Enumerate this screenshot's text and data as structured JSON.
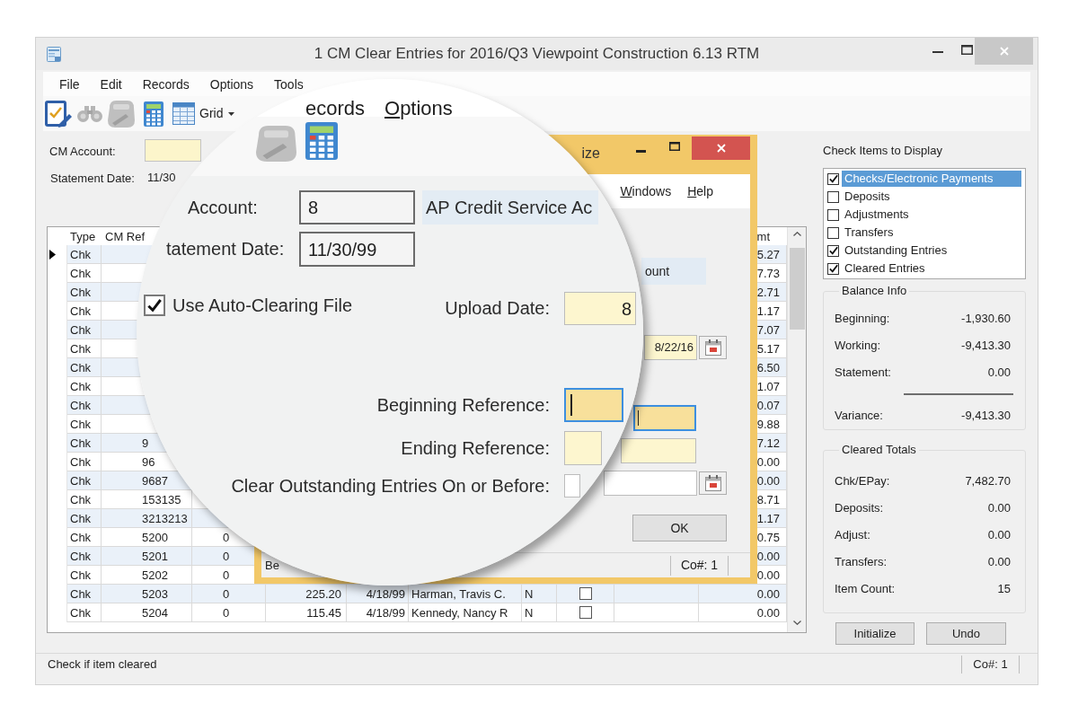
{
  "window": {
    "title": "1 CM Clear Entries for 2016/Q3 Viewpoint Construction 6.13 RTM"
  },
  "menu": [
    {
      "label": "File"
    },
    {
      "label": "Edit"
    },
    {
      "label": "Records"
    },
    {
      "label": "Options"
    },
    {
      "label": "Tools"
    }
  ],
  "toolbar": {
    "buttons": [
      {
        "disabled": false
      },
      {
        "disabled": true
      },
      {
        "disabled": true
      },
      {
        "disabled": false
      }
    ],
    "grid_dropdown": {
      "label": "Grid"
    }
  },
  "account": {
    "cm_account_label": "CM Account:",
    "statement_date_label": "Statement Date:",
    "statement_date_value": "11/30"
  },
  "grid": {
    "header": {
      "type": "Type",
      "cm_ref": "CM Ref",
      "column_10": "mt"
    },
    "rows": [
      {
        "current": true,
        "type": "Chk",
        "column_10": "5.27"
      },
      {
        "current": false,
        "type": "Chk",
        "column_10": "7.73"
      },
      {
        "current": false,
        "type": "Chk",
        "column_10": "2.71"
      },
      {
        "current": false,
        "type": "Chk",
        "column_10": "1.17"
      },
      {
        "current": false,
        "type": "Chk",
        "column_10": "7.07"
      },
      {
        "current": false,
        "type": "Chk",
        "column_10": "5.17"
      },
      {
        "current": false,
        "type": "Chk",
        "column_10": "6.50"
      },
      {
        "current": false,
        "type": "Chk",
        "column_10": "1.07"
      },
      {
        "current": false,
        "type": "Chk",
        "column_10": "0.07"
      },
      {
        "current": false,
        "type": "Chk",
        "column_10": "9.88"
      },
      {
        "current": false,
        "type": "Chk",
        "cm_ref": "9",
        "column_10": "7.12"
      },
      {
        "current": false,
        "type": "Chk",
        "cm_ref": "96",
        "column_10": "0.00"
      },
      {
        "current": false,
        "type": "Chk",
        "cm_ref": "9687",
        "column_10": "0.00"
      },
      {
        "current": false,
        "type": "Chk",
        "cm_ref": "153135",
        "column_10": "8.71"
      },
      {
        "current": false,
        "type": "Chk",
        "cm_ref": "3213213",
        "column_10": "1.17"
      },
      {
        "current": false,
        "type": "Chk",
        "cm_ref": "5200",
        "column_3": "0",
        "column_10": "0.75"
      },
      {
        "current": false,
        "type": "Chk",
        "cm_ref": "5201",
        "column_3": "0",
        "column_10": "0.00"
      },
      {
        "current": false,
        "type": "Chk",
        "cm_ref": "5202",
        "column_3": "0",
        "column_10": "0.00"
      },
      {
        "current": false,
        "type": "Chk",
        "cm_ref": "5203",
        "column_3": "0",
        "column_4": "225.20",
        "column_5": "4/18/99",
        "column_6": "Harman, Travis C.",
        "column_7": "N",
        "column_8": {
          "checked": false
        },
        "column_10": "0.00"
      },
      {
        "current": false,
        "type": "Chk",
        "cm_ref": "5204",
        "column_3": "0",
        "column_4": "115.45",
        "column_5": "4/18/99",
        "column_6": "Kennedy, Nancy R",
        "column_7": "N",
        "column_8": {
          "checked": false
        },
        "column_10": "0.00"
      }
    ]
  },
  "dialog": {
    "title": "ize",
    "menu": [
      {
        "label": "Windows",
        "underlined_initial": true
      },
      {
        "label": "Help",
        "underlined_initial": true
      }
    ],
    "account_name": "ount",
    "fields": [
      {
        "kind": "date",
        "value": "8/22/16",
        "required": true,
        "focused": false
      },
      {
        "kind": "text",
        "required": true,
        "focused": true
      },
      {
        "kind": "text",
        "required": true,
        "focused": false
      },
      {
        "kind": "date",
        "required": false,
        "focused": false
      }
    ],
    "ok_button": "OK",
    "status_left": "Be",
    "status_company": "Co#: 1"
  },
  "magnifier": {
    "menu": [
      {
        "label": "ecords",
        "underlined_initial": false
      },
      {
        "label": "Options",
        "underlined_initial": true
      }
    ],
    "toolbar": [
      {
        "disabled": true
      },
      {
        "disabled": false
      }
    ],
    "account_label": "Account:",
    "account_value": "8",
    "account_name": "AP Credit Service Ac",
    "statement_date_label": "tatement Date:",
    "statement_date_value": "11/30/99",
    "auto_clearing": {
      "label": "Use Auto-Clearing File",
      "checked": true
    },
    "fields": [
      {
        "label": "Upload Date:",
        "value": "8",
        "required": true,
        "focused": false
      },
      {
        "label": "Beginning Reference:",
        "required": true,
        "focused": true
      },
      {
        "label": "Ending Reference:",
        "required": true,
        "focused": false
      },
      {
        "label": "Clear Outstanding Entries On or Before:",
        "required": false,
        "focused": false
      }
    ]
  },
  "display_items": {
    "title": "Check Items to Display",
    "items": [
      {
        "label": "Checks/Electronic Payments",
        "checked": true,
        "selected": true
      },
      {
        "label": "Deposits",
        "checked": false,
        "selected": false
      },
      {
        "label": "Adjustments",
        "checked": false,
        "selected": false
      },
      {
        "label": "Transfers",
        "checked": false,
        "selected": false
      },
      {
        "label": "Outstanding Entries",
        "checked": true,
        "selected": false
      },
      {
        "label": "Cleared Entries",
        "checked": true,
        "selected": false
      }
    ]
  },
  "balance_info": {
    "title": "Balance Info",
    "rows": [
      {
        "kind": "line",
        "label": "Beginning:",
        "value": "-1,930.60"
      },
      {
        "kind": "line",
        "label": "Working:",
        "value": "-9,413.30"
      },
      {
        "kind": "line",
        "label": "Statement:",
        "value": "0.00"
      },
      {
        "kind": "total",
        "label": "Variance:",
        "value": "-9,413.30"
      }
    ]
  },
  "cleared_totals": {
    "title": "Cleared Totals",
    "rows": [
      {
        "kind": "line",
        "label": "Chk/EPay:",
        "value": "7,482.70"
      },
      {
        "kind": "line",
        "label": "Deposits:",
        "value": "0.00"
      },
      {
        "kind": "line",
        "label": "Adjust:",
        "value": "0.00"
      },
      {
        "kind": "line",
        "label": "Transfers:",
        "value": "0.00"
      },
      {
        "kind": "line",
        "label": "Item Count:",
        "value": "15"
      }
    ]
  },
  "buttons": [
    {
      "label": "Initialize"
    },
    {
      "label": "Undo"
    }
  ],
  "status_bar": {
    "message": "Check if item cleared",
    "company": "Co#: 1"
  }
}
